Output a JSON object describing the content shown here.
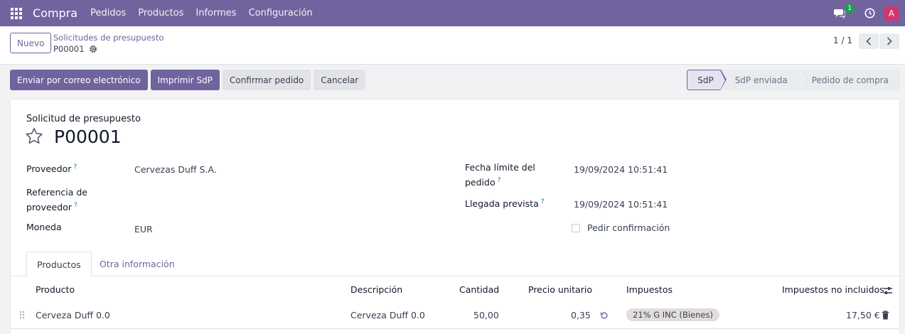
{
  "navbar": {
    "app_name": "Compra",
    "menu": [
      "Pedidos",
      "Productos",
      "Informes",
      "Configuración"
    ],
    "chat_badge": "1",
    "avatar_letter": "A",
    "accent_color": "#71639e"
  },
  "control": {
    "new_button": "Nuevo",
    "breadcrumb_parent": "Solicitudes de presupuesto",
    "breadcrumb_current": "P00001",
    "pager": "1 / 1"
  },
  "actions": {
    "send_email": "Enviar por correo electrónico",
    "print": "Imprimir SdP",
    "confirm": "Confirmar pedido",
    "cancel": "Cancelar"
  },
  "status": {
    "steps": [
      "SdP",
      "SdP enviada",
      "Pedido de compra"
    ],
    "active": "SdP"
  },
  "form": {
    "doc_label": "Solicitud de presupuesto",
    "doc_name": "P00001",
    "vendor_label": "Proveedor",
    "vendor_value": "Cervezas Duff S.A.",
    "vendor_ref_label_1": "Referencia de",
    "vendor_ref_label_2": "proveedor",
    "currency_label": "Moneda",
    "currency_value": "EUR",
    "deadline_label_1": "Fecha límite del",
    "deadline_label_2": "pedido",
    "deadline_value": "19/09/2024 10:51:41",
    "arrival_label": "Llegada prevista",
    "arrival_value": "19/09/2024 10:51:41",
    "confirm_label": "Pedir confirmación",
    "help_mark": "?"
  },
  "tabs": [
    "Productos",
    "Otra información"
  ],
  "table": {
    "headers": [
      "Producto",
      "Descripción",
      "Cantidad",
      "Precio unitario",
      "Impuestos",
      "Impuestos no incluidos"
    ],
    "rows": [
      {
        "product": "Cerveza Duff 0.0",
        "description": "Cerveza Duff 0.0",
        "quantity": "50,00",
        "unit_price": "0,35",
        "tax": "21% G INC (Bienes)",
        "subtotal": "17,50 €"
      }
    ]
  }
}
